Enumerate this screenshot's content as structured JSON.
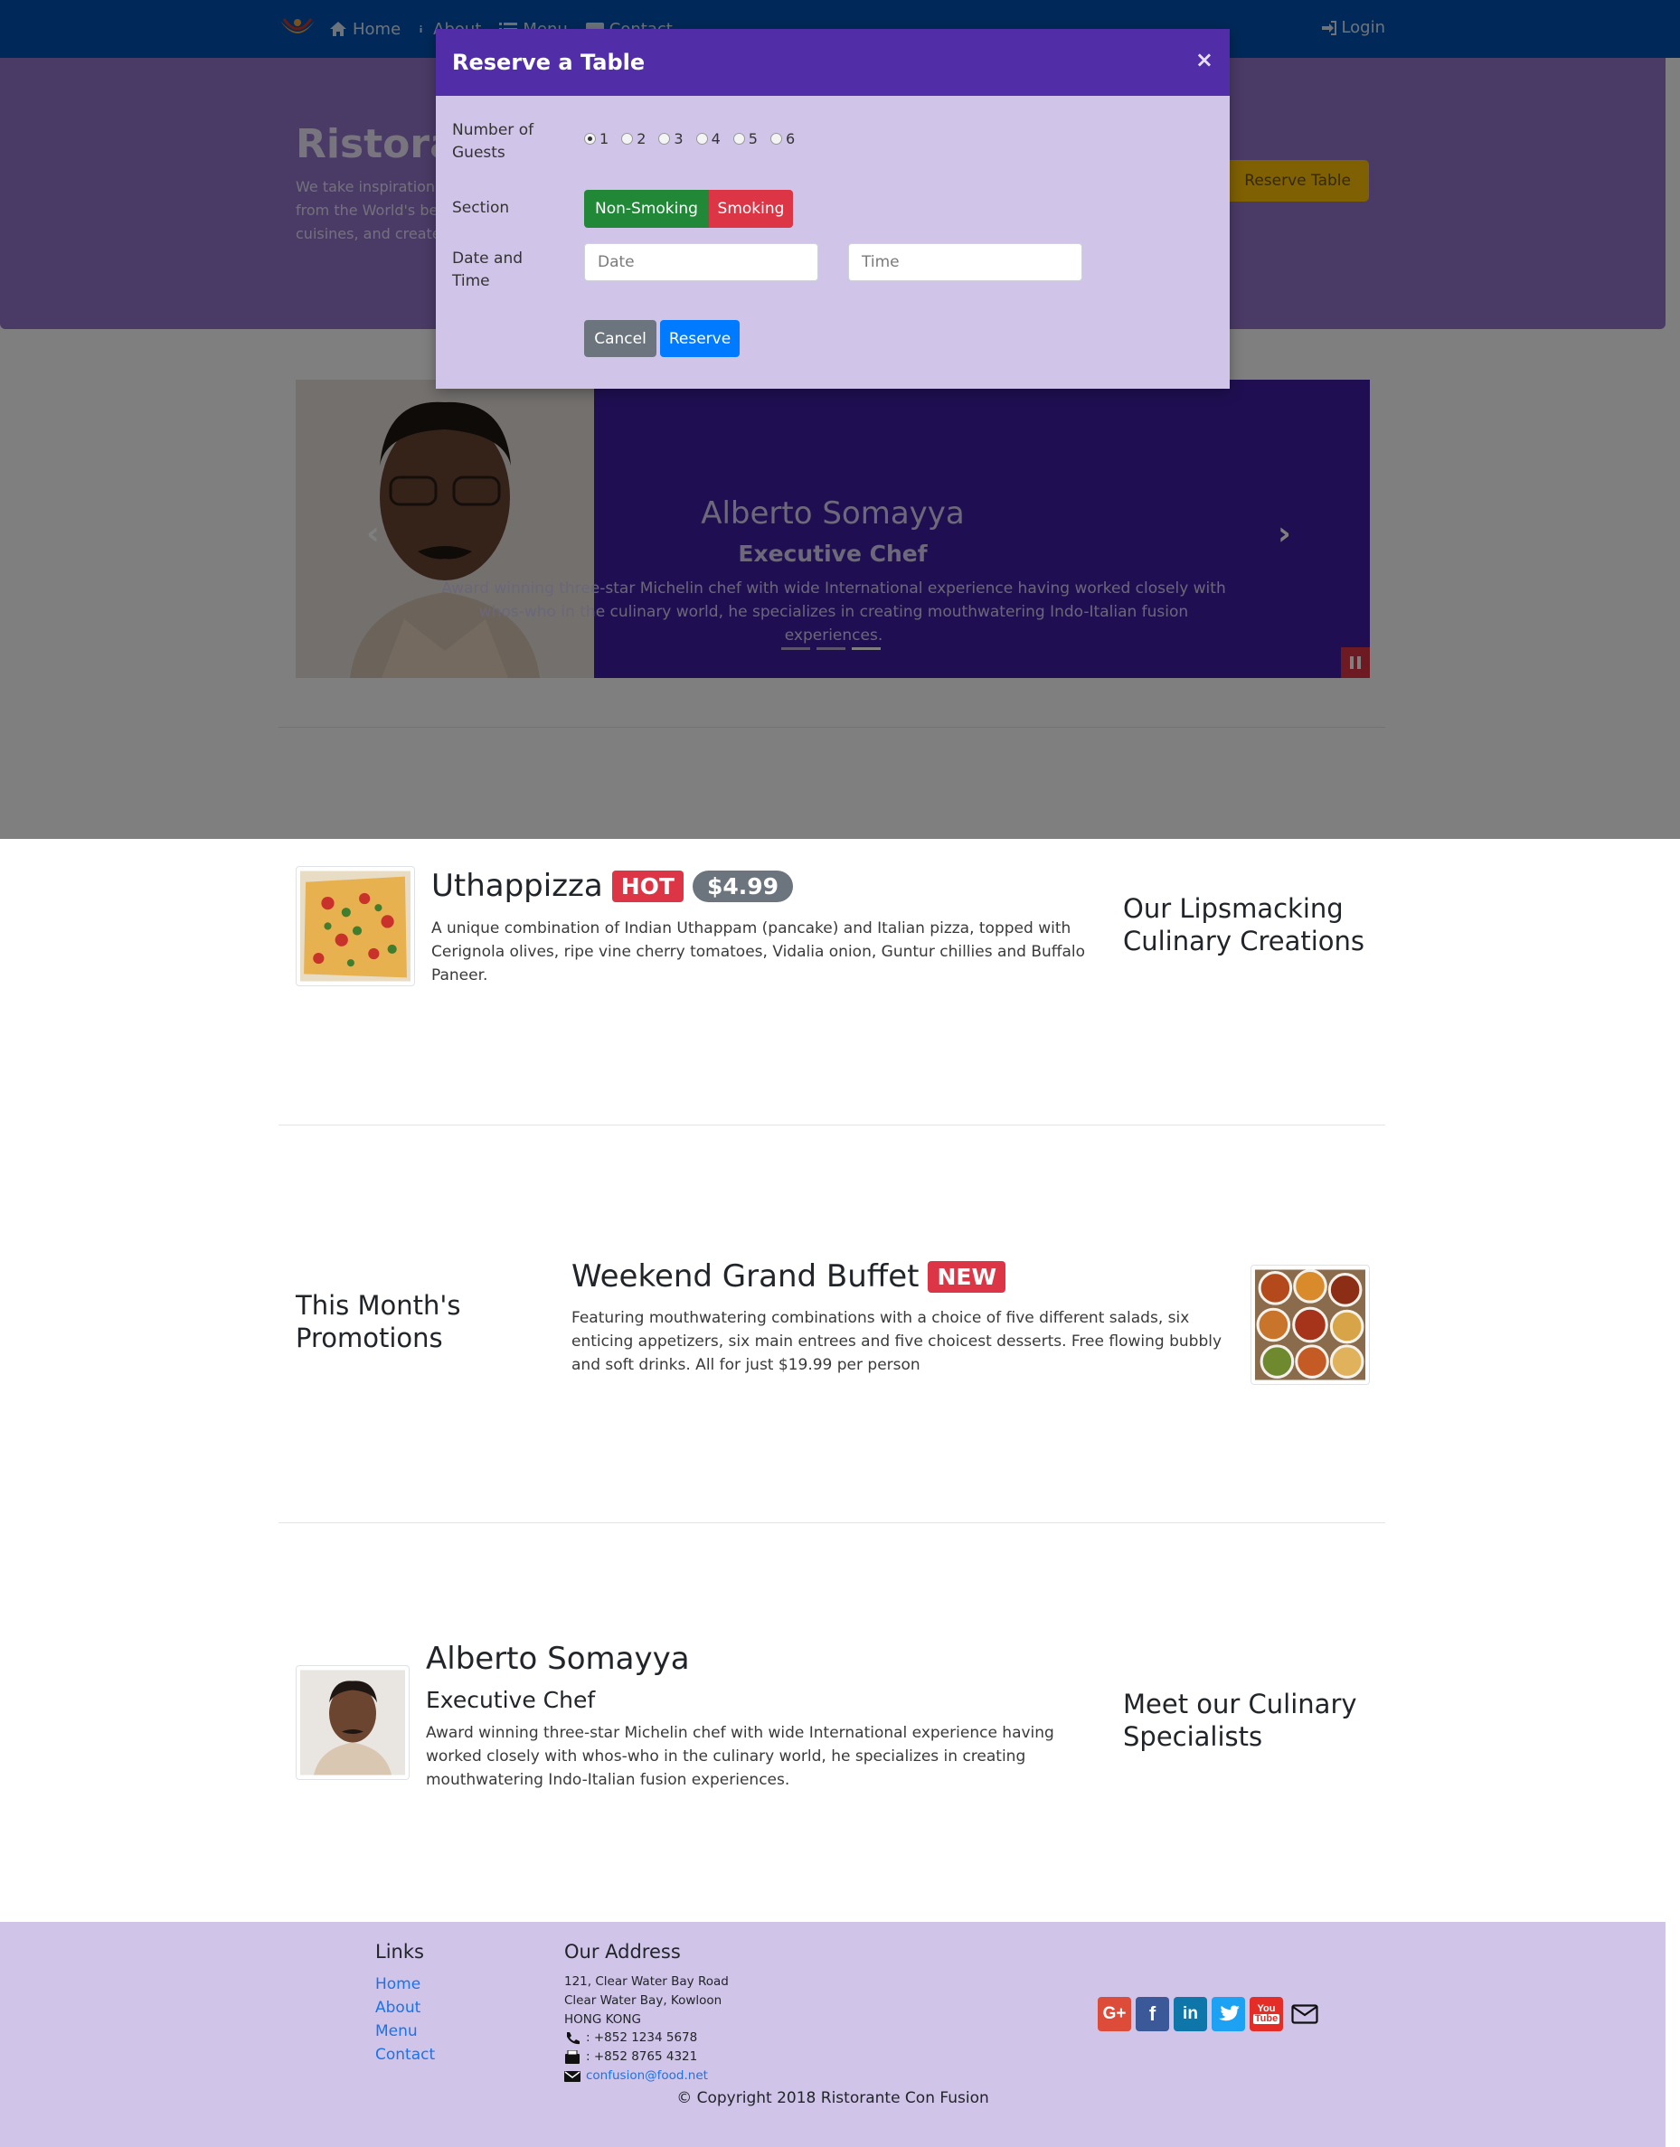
{
  "navbar": {
    "items": [
      {
        "label": "Home",
        "icon": "home-icon"
      },
      {
        "label": "About",
        "icon": "info-icon"
      },
      {
        "label": "Menu",
        "icon": "list-icon"
      },
      {
        "label": "Contact",
        "icon": "address-card-icon"
      }
    ],
    "login": "Login"
  },
  "jumbotron": {
    "title": "Ristorante Con Fusion",
    "text": "We take inspiration from the World's best cuisines, and create a unique fusion experience. Our lipsmacking creations will tickle your culinary senses!",
    "reserve_button": "Reserve Table"
  },
  "modal": {
    "title": "Reserve a Table",
    "close": "×",
    "guests_label": "Number of Guests",
    "guest_options": [
      "1",
      "2",
      "3",
      "4",
      "5",
      "6"
    ],
    "selected_guests": "1",
    "section_label": "Section",
    "section_options": [
      "Non-Smoking",
      "Smoking"
    ],
    "datetime_label": "Date and Time",
    "date_placeholder": "Date",
    "time_placeholder": "Time",
    "cancel": "Cancel",
    "reserve": "Reserve"
  },
  "carousel": {
    "title": "Alberto Somayya",
    "subtitle": "Executive Chef",
    "text": "Award winning three-star Michelin chef with wide International experience having worked closely with whos-who in the culinary world, he specializes in creating mouthwatering Indo-Italian fusion experiences.",
    "prev": "‹",
    "next": "›",
    "active_slide": 3,
    "slide_count": 3
  },
  "dish": {
    "title": "Uthappizza",
    "badge": "HOT",
    "price": "$4.99",
    "text": "A unique combination of Indian Uthappam (pancake) and Italian pizza, topped with Cerignola olives, ripe vine cherry tomatoes, Vidalia onion, Guntur chillies and Buffalo Paneer.",
    "side_heading": "Our Lipsmacking Culinary Creations"
  },
  "promotion": {
    "side_heading": "This Month's Promotions",
    "title": "Weekend Grand Buffet",
    "badge": "NEW",
    "text": "Featuring mouthwatering combinations with a choice of five different salads, six enticing appetizers, six main entrees and five choicest desserts. Free flowing bubbly and soft drinks. All for just $19.99 per person"
  },
  "leader": {
    "name": "Alberto Somayya",
    "designation": "Executive Chef",
    "text": "Award winning three-star Michelin chef with wide International experience having worked closely with whos-who in the culinary world, he specializes in creating mouthwatering Indo-Italian fusion experiences.",
    "side_heading": "Meet our Culinary Specialists"
  },
  "footer": {
    "links_heading": "Links",
    "links": [
      "Home",
      "About",
      "Menu",
      "Contact"
    ],
    "address_heading": "Our Address",
    "address_lines": [
      "121, Clear Water Bay Road",
      "Clear Water Bay, Kowloon",
      "HONG KONG"
    ],
    "phone": ": +852 1234 5678",
    "fax": ": +852 8765 4321",
    "email": "confusion@food.net",
    "social": [
      "google-plus-icon",
      "facebook-icon",
      "linkedin-icon",
      "twitter-icon",
      "youtube-icon",
      "envelope-icon"
    ],
    "copyright": "© Copyright 2018 Ristorante Con Fusion"
  },
  "colors": {
    "navbar": "#0053b3",
    "jumbotron": "#9575cd",
    "modal_header": "#512da8",
    "modal_body": "#d1c4e9",
    "footer": "#d1c4e9",
    "accent_yellow": "#ffc107",
    "danger": "#dc3545",
    "success": "#218838",
    "primary": "#007bff"
  }
}
